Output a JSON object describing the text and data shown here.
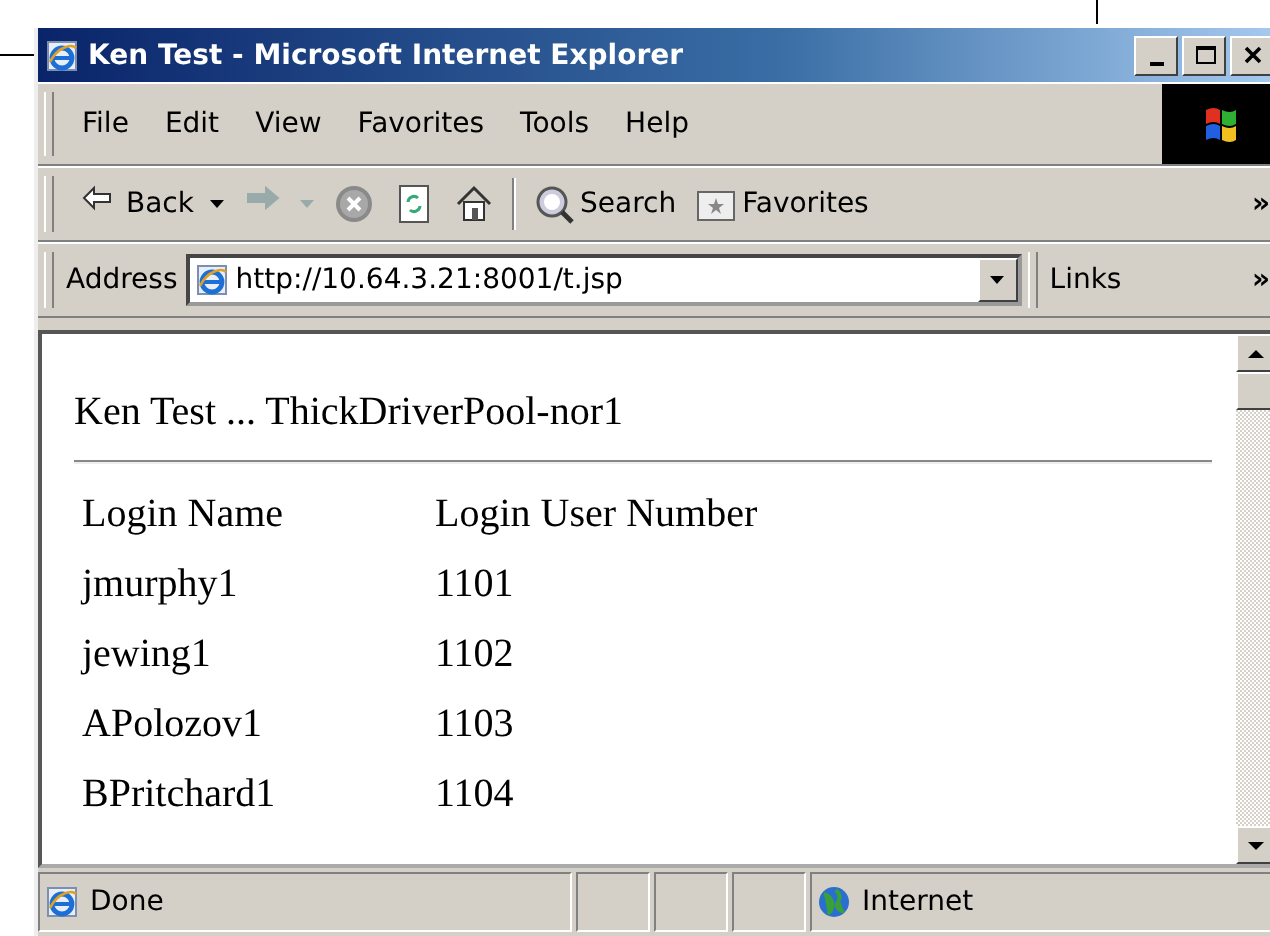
{
  "window": {
    "title": "Ken Test - Microsoft Internet Explorer"
  },
  "menu": [
    {
      "label": "File"
    },
    {
      "label": "Edit"
    },
    {
      "label": "View"
    },
    {
      "label": "Favorites"
    },
    {
      "label": "Tools"
    },
    {
      "label": "Help"
    }
  ],
  "toolbar": {
    "buttons": [
      {
        "kind": "back",
        "label": "Back",
        "disabled": false
      },
      {
        "kind": "forward",
        "disabled": true
      },
      {
        "kind": "stop"
      },
      {
        "kind": "refresh"
      },
      {
        "kind": "home"
      },
      {
        "kind": "search",
        "label": "Search"
      },
      {
        "kind": "favorites",
        "label": "Favorites"
      }
    ],
    "more": "»"
  },
  "address_bar": {
    "label": "Address",
    "value": "http://10.64.3.21:8001/t.jsp",
    "links": "Links",
    "more": "»"
  },
  "page": {
    "heading": "Ken Test ... ThickDriverPool-nor1",
    "columns": [
      "Login Name",
      "Login User Number"
    ],
    "rows": [
      [
        "jmurphy1",
        "1101"
      ],
      [
        "jewing1",
        "1102"
      ],
      [
        "APolozov1",
        "1103"
      ],
      [
        "BPritchard1",
        "1104"
      ]
    ]
  },
  "status_bar": {
    "text": "Done",
    "zone": "Internet"
  }
}
